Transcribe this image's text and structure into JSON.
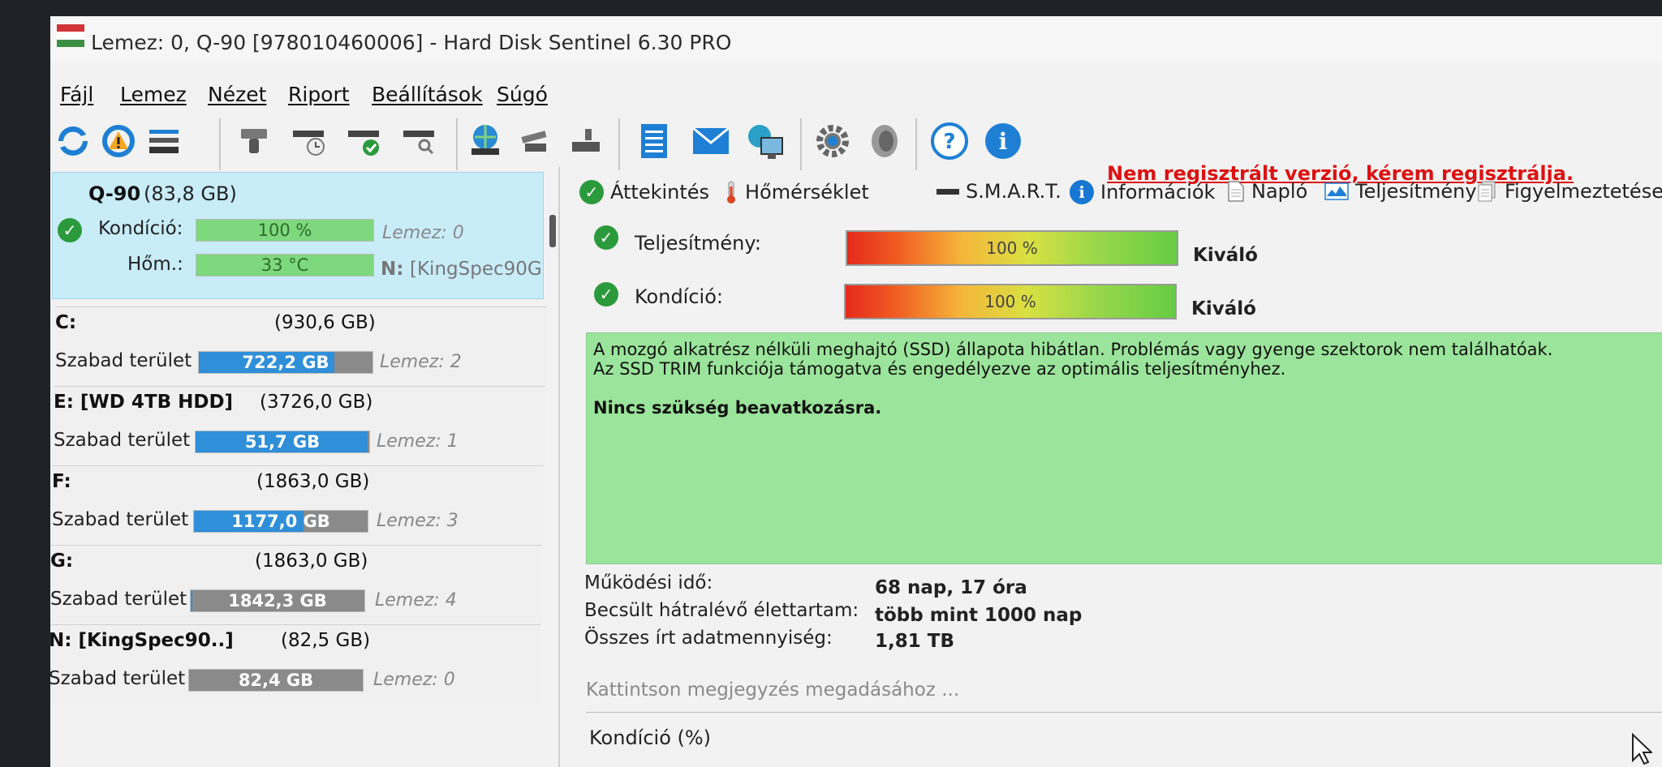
{
  "window": {
    "title": "Lemez: 0, Q-90 [978010460006]  -  Hard Disk Sentinel 6.30 PRO"
  },
  "menu": [
    "Fájl",
    "Lemez",
    "Nézet",
    "Riport",
    "Beállítások",
    "Súgó"
  ],
  "toolbar": {
    "icons": [
      "refresh-icon",
      "refresh-warning-icon",
      "disk-list-icon",
      "disk-tool-icon",
      "disk-schedule-icon",
      "disk-check-icon",
      "disk-search-icon",
      "globe-disk-icon",
      "usb-disk-icon",
      "network-disk-icon",
      "report-icon",
      "email-icon",
      "web-icon",
      "settings-gear-icon",
      "sound-icon",
      "help-icon",
      "info-icon"
    ],
    "register_notice": "Nem regisztrált verzió, kérem regisztrálja."
  },
  "disk": {
    "name": "Q-90",
    "size": "(83,8 GB)",
    "condition_label": "Kondíció:",
    "condition_value": "100 %",
    "condition_pct": 100,
    "disk_index": "Lemez: 0",
    "temp_label": "Hőm.:",
    "temp_value": "33 °C",
    "temp_pct": 100,
    "volume_prefix": "N:",
    "volume_name": "[KingSpec90G"
  },
  "volumes": [
    {
      "name": "C:",
      "size": "(930,6 GB)",
      "free_label": "Szabad terület",
      "free": "722,2 GB",
      "free_pct": 0.78,
      "disk": "Lemez: 2"
    },
    {
      "name": "E: [WD 4TB HDD]",
      "size": "(3726,0 GB)",
      "free_label": "Szabad terület",
      "free": "51,7 GB",
      "free_pct": 0.99,
      "disk": "Lemez: 1"
    },
    {
      "name": "F:",
      "size": "(1863,0 GB)",
      "free_label": "Szabad terület",
      "free": "1177,0 GB",
      "free_pct": 0.63,
      "disk": "Lemez: 3"
    },
    {
      "name": "G:",
      "size": "(1863,0 GB)",
      "free_label": "Szabad terület",
      "free": "1842,3 GB",
      "free_pct": 0.01,
      "disk": "Lemez: 4"
    },
    {
      "name": "N: [KingSpec90..]",
      "size": "(82,5 GB)",
      "free_label": "Szabad terület",
      "free": "82,4 GB",
      "free_pct": 0.0,
      "disk": "Lemez: 0"
    }
  ],
  "tabs": [
    "Áttekintés",
    "Hőmérséklet",
    "S.M.A.R.T.",
    "Információk",
    "Napló",
    "Teljesítmény",
    "Figyelmeztetések"
  ],
  "overview": {
    "performance_label": "Teljesítmény:",
    "performance_value": "100 %",
    "performance_rating": "Kiváló",
    "condition_label": "Kondíció:",
    "condition_value": "100 %",
    "condition_rating": "Kiváló",
    "status_line1": "A mozgó alkatrész nélküli meghajtó (SSD) állapota hibátlan. Problémás vagy gyenge szektorok nem találhatóak.",
    "status_line2": "Az SSD TRIM funkciója támogatva és engedélyezve az optimális teljesítményhez.",
    "status_action": "Nincs szükség beavatkozásra.",
    "uptime_label": "Működési idő:",
    "uptime_value": "68 nap, 17 óra",
    "lifetime_label": "Becsült hátralévő élettartam:",
    "lifetime_value": "több mint 1000 nap",
    "written_label": "Összes írt adatmennyiség:",
    "written_value": "1,81 TB",
    "note_placeholder": "Kattintson megjegyzés megadásához ...",
    "condition_chart_label": "Kondíció  (%)"
  },
  "colors": {
    "selected_disk_bg": "#c8ecf8",
    "good_bar": "#7ed87e",
    "free_space": "#2f8fd8",
    "status_bg": "#9be49b",
    "register_link": "#dd1111"
  }
}
